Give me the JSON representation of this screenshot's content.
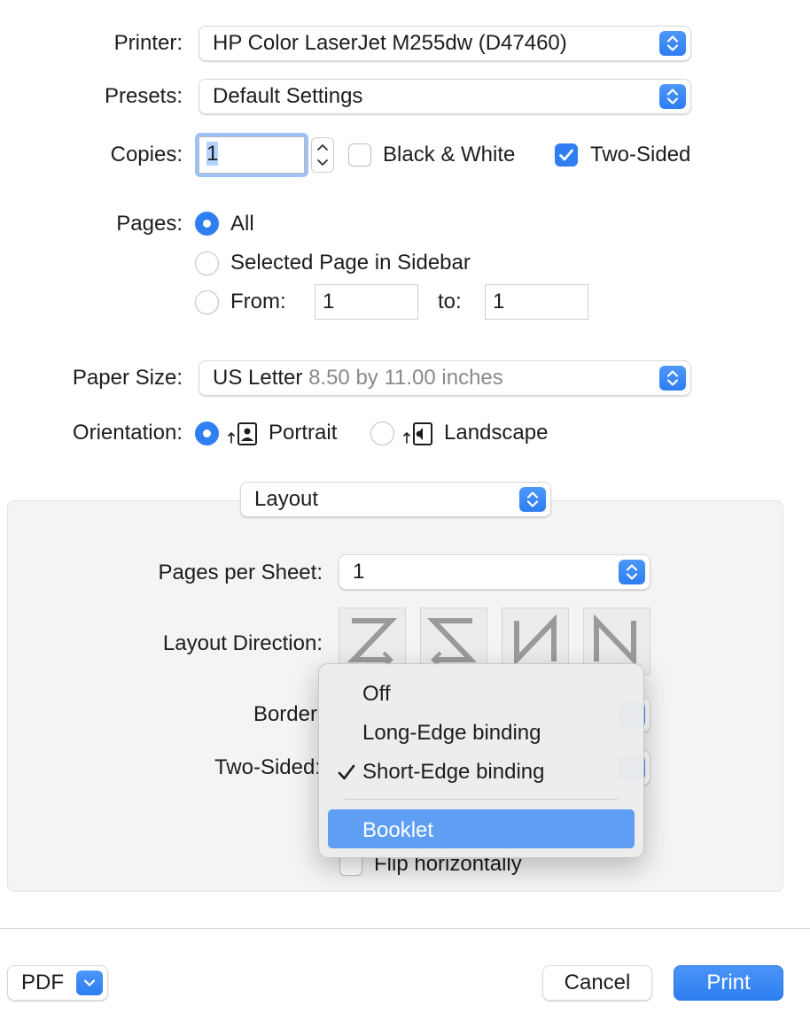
{
  "printer": {
    "label": "Printer:",
    "value": "HP Color LaserJet M255dw (D47460)"
  },
  "presets": {
    "label": "Presets:",
    "value": "Default Settings"
  },
  "copies": {
    "label": "Copies:",
    "value": "1",
    "bw_label": "Black & White",
    "bw_checked": false,
    "two_sided_label": "Two-Sided",
    "two_sided_checked": true
  },
  "pages": {
    "label": "Pages:",
    "all": "All",
    "selected": "Selected Page in Sidebar",
    "from_label": "From:",
    "from_value": "1",
    "to_label": "to:",
    "to_value": "1",
    "checked": "All"
  },
  "paper": {
    "label": "Paper Size:",
    "value": "US Letter",
    "detail": "8.50 by 11.00 inches"
  },
  "orientation": {
    "label": "Orientation:",
    "portrait": "Portrait",
    "landscape": "Landscape",
    "checked": "Portrait"
  },
  "section": {
    "value": "Layout"
  },
  "layout": {
    "pages_per_sheet_label": "Pages per Sheet:",
    "pages_per_sheet": "1",
    "direction_label": "Layout Direction:",
    "border_label": "Border",
    "two_sided_label": "Two-Sided:",
    "flip_label": "Flip horizontally",
    "flip_checked": false
  },
  "menu": {
    "items": [
      "Off",
      "Long-Edge binding",
      "Short-Edge binding",
      "Booklet"
    ],
    "checked": "Short-Edge binding",
    "highlighted": "Booklet"
  },
  "footer": {
    "pdf": "PDF",
    "cancel": "Cancel",
    "print": "Print"
  },
  "colors": {
    "accent": "#2f7ff3",
    "highlight": "#5e9ff3",
    "panel": "#f4f4f5"
  }
}
